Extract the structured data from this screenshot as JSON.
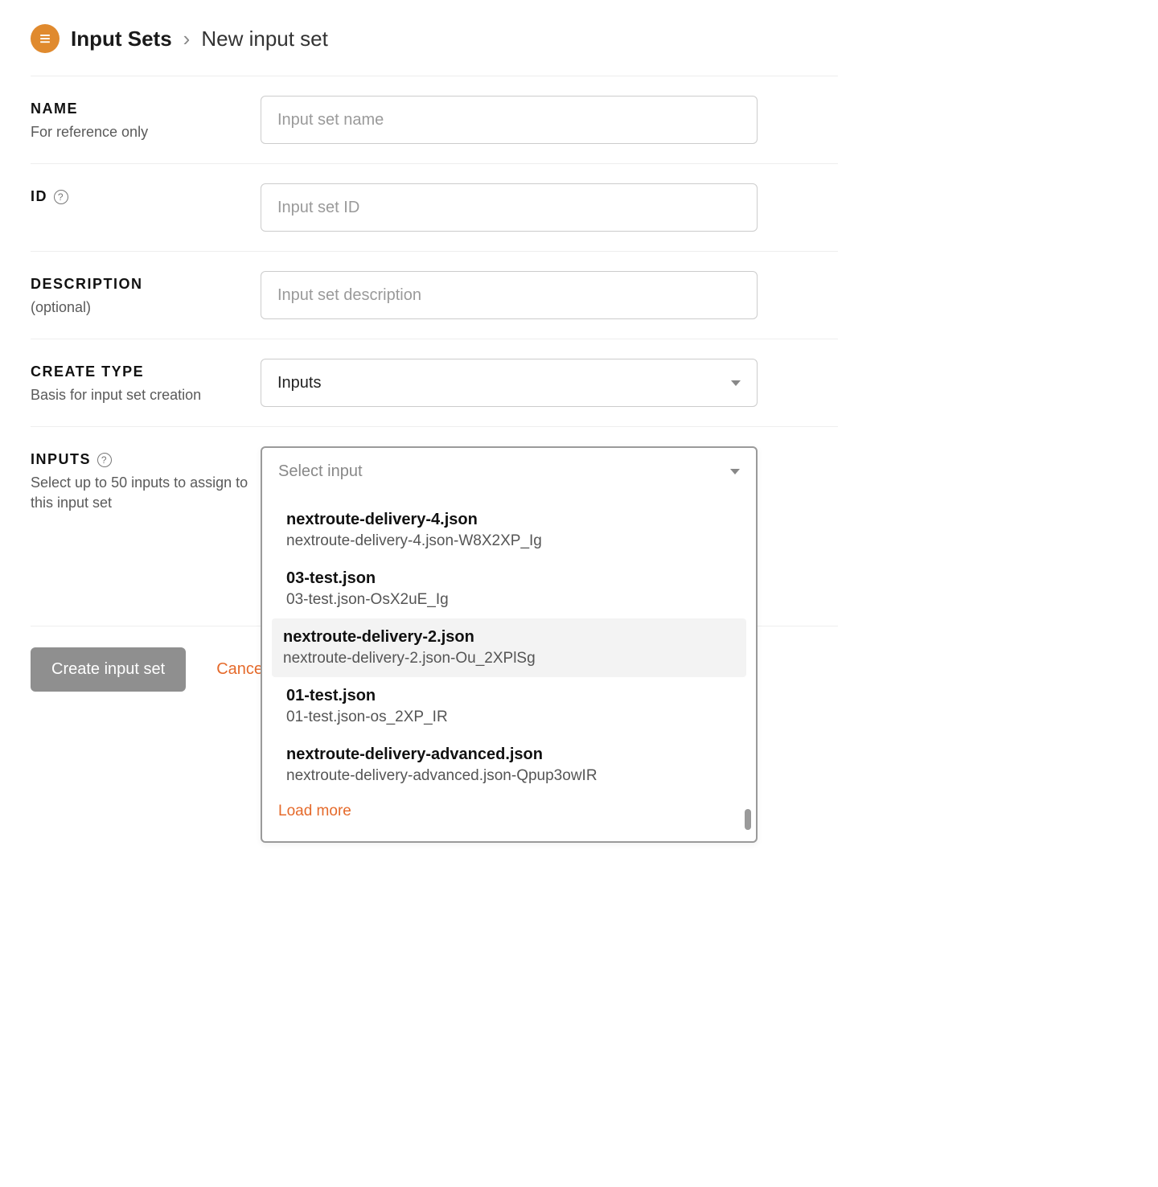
{
  "header": {
    "breadcrumb_root": "Input Sets",
    "breadcrumb_current": "New input set"
  },
  "fields": {
    "name": {
      "label": "NAME",
      "help": "For reference only",
      "placeholder": "Input set name",
      "value": ""
    },
    "id": {
      "label": "ID",
      "placeholder": "Input set ID",
      "value": ""
    },
    "description": {
      "label": "DESCRIPTION",
      "help": "(optional)",
      "placeholder": "Input set description",
      "value": ""
    },
    "create_type": {
      "label": "CREATE TYPE",
      "help": "Basis for input set creation",
      "selected": "Inputs"
    },
    "inputs": {
      "label": "INPUTS",
      "help": "Select up to 50 inputs to assign to this input set",
      "placeholder": "Select input",
      "options": [
        {
          "title": "nextroute-delivery-4.json",
          "sub": "nextroute-delivery-4.json-W8X2XP_Ig",
          "hovered": false
        },
        {
          "title": "03-test.json",
          "sub": "03-test.json-OsX2uE_Ig",
          "hovered": false
        },
        {
          "title": "nextroute-delivery-2.json",
          "sub": "nextroute-delivery-2.json-Ou_2XPlSg",
          "hovered": true
        },
        {
          "title": "01-test.json",
          "sub": "01-test.json-os_2XP_IR",
          "hovered": false
        },
        {
          "title": "nextroute-delivery-advanced.json",
          "sub": "nextroute-delivery-advanced.json-Qpup3owIR",
          "hovered": false
        }
      ],
      "load_more": "Load more"
    }
  },
  "actions": {
    "create": "Create input set",
    "cancel": "Cancel"
  }
}
